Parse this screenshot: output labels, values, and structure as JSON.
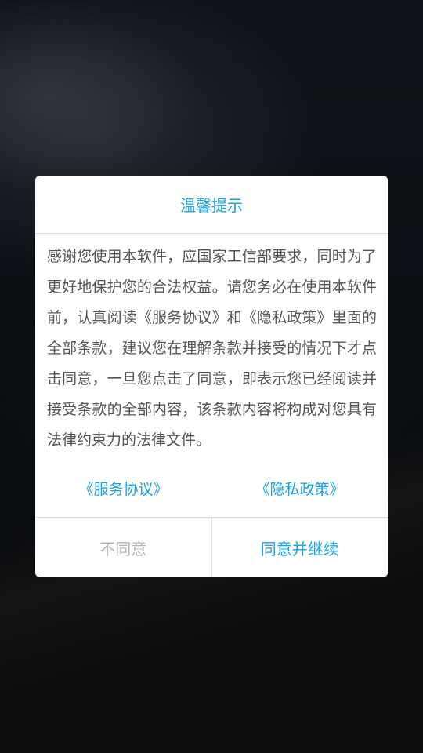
{
  "dialog": {
    "title": "温馨提示",
    "body": "感谢您使用本软件，应国家工信部要求，同时为了更好地保护您的合法权益。请您务必在使用本软件前，认真阅读《服务协议》和《隐私政策》里面的全部条款，建议您在理解条款并接受的情况下才点击同意，一旦您点击了同意，即表示您已经阅读并接受条款的全部内容，该条款内容将构成对您具有法律约束力的法律文件。",
    "links": {
      "service_agreement": "《服务协议》",
      "privacy_policy": "《隐私政策》"
    },
    "buttons": {
      "disagree": "不同意",
      "agree": "同意并继续"
    }
  },
  "colors": {
    "accent": "#1aa3e8",
    "disabled_text": "#b5b5b5",
    "body_text": "#555555"
  }
}
